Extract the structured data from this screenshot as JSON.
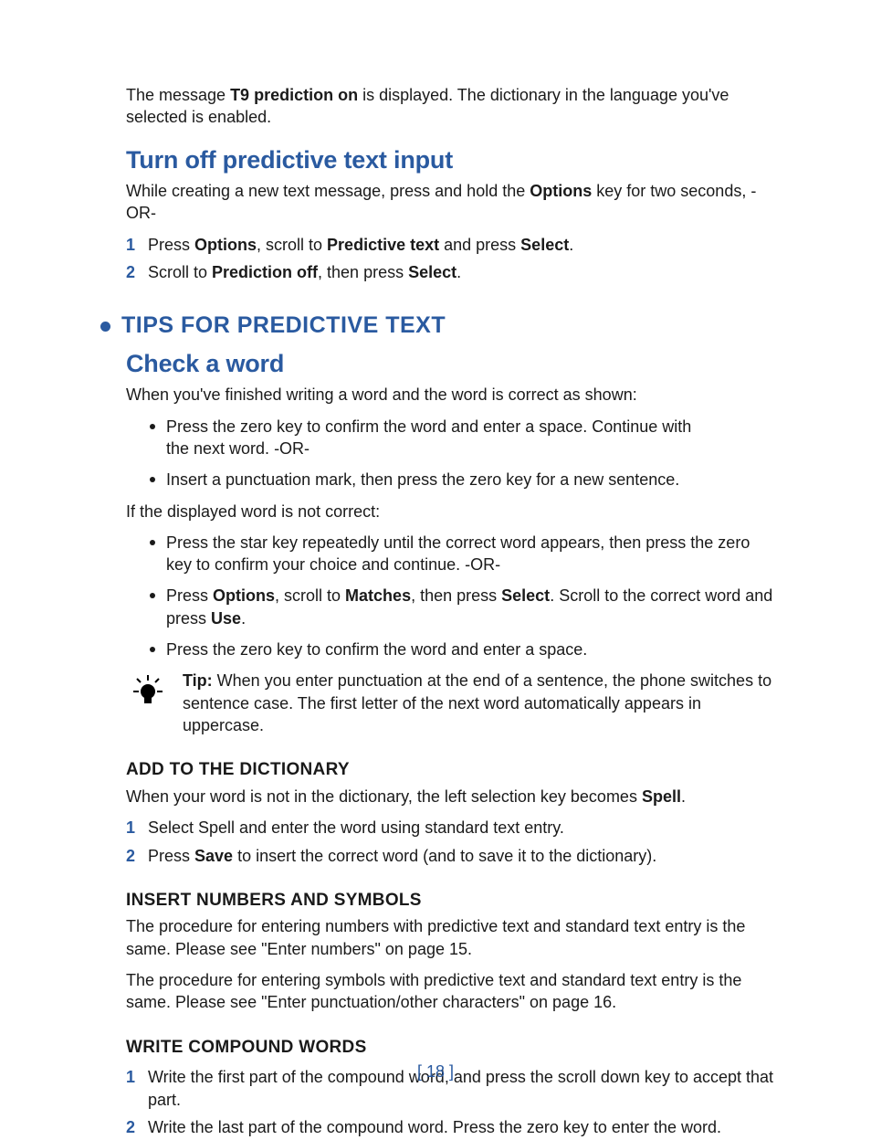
{
  "intro": {
    "pre": "The message ",
    "bold": "T9 prediction on",
    "post": " is displayed. The dictionary in the language you've selected is enabled."
  },
  "turn_off": {
    "heading": "Turn off predictive text input",
    "para_pre": "While creating a new text message, press and hold the ",
    "para_bold": "Options",
    "para_post": " key for two seconds, -OR-",
    "step1": {
      "pre": "Press ",
      "b1": "Options",
      "mid1": ", scroll to ",
      "b2": "Predictive text",
      "mid2": " and press ",
      "b3": "Select",
      "post": "."
    },
    "step2": {
      "pre": "Scroll to ",
      "b1": "Prediction off",
      "mid1": ", then press ",
      "b2": "Select",
      "post": "."
    }
  },
  "tips": {
    "heading": "TIPS FOR PREDICTIVE TEXT"
  },
  "check": {
    "heading": "Check a word",
    "intro": "When you've finished writing a word and the word is correct as shown:",
    "b1": "Press the zero key to confirm the word and enter a space. Continue with the next word. -OR-",
    "b2": "Insert a punctuation mark, then press the zero key for a new sentence.",
    "intro2": "If the displayed word is not correct:",
    "b3": "Press the star key repeatedly until the correct word appears, then press the zero key to confirm your choice and continue. -OR-",
    "b4": {
      "pre": "Press ",
      "b1": "Options",
      "mid1": ", scroll to ",
      "b2": "Matches",
      "mid2": ", then press ",
      "b3": "Select",
      "mid3": ". Scroll to the correct word and press ",
      "b4": "Use",
      "post": "."
    },
    "b5": "Press the zero key to confirm the word and enter a space.",
    "tip_label": "Tip:",
    "tip_text": " When you enter punctuation at the end of a sentence, the phone switches to sentence case. The first letter of the next word automatically appears in uppercase."
  },
  "add_dict": {
    "heading": "ADD TO THE DICTIONARY",
    "para_pre": "When your word is not in the dictionary, the left selection key becomes ",
    "para_bold": "Spell",
    "para_post": ".",
    "s1": "Select Spell and enter the word using standard text entry.",
    "s2": {
      "pre": "Press ",
      "b": "Save",
      "post": " to insert the correct word (and to save it to the dictionary)."
    }
  },
  "insert_num": {
    "heading": "INSERT NUMBERS AND SYMBOLS",
    "p1": "The procedure for entering numbers with predictive text and standard text entry is the same. Please see \"Enter numbers\" on page 15.",
    "p2": "The procedure for entering symbols with predictive text and standard text entry is the same. Please see \"Enter punctuation/other characters\" on page 16."
  },
  "compound": {
    "heading": "WRITE COMPOUND WORDS",
    "s1": "Write the first part of the compound word, and press the scroll down key to accept that part.",
    "s2": "Write the last part of the compound word. Press the zero key to enter the word."
  },
  "footer": "[ 18 ]"
}
